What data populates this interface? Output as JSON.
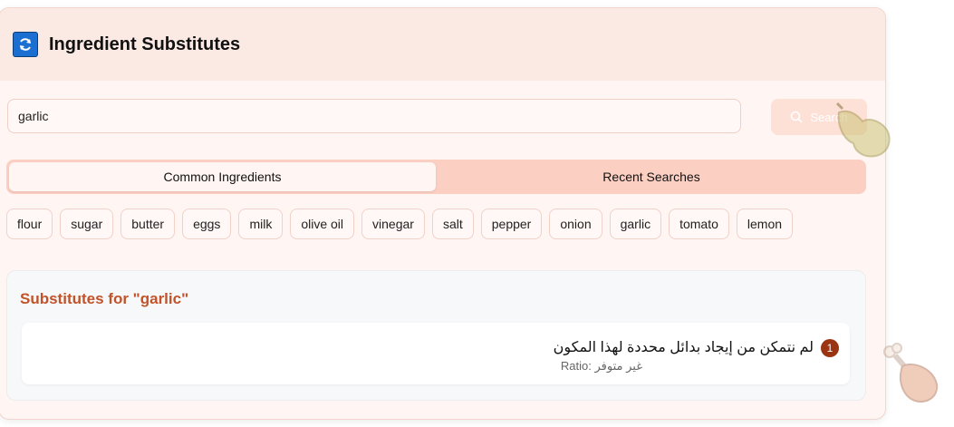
{
  "header": {
    "title": "Ingredient Substitutes",
    "icon": "refresh-icon"
  },
  "search": {
    "value": "garlic",
    "button_label": "Search"
  },
  "tabs": [
    {
      "label": "Common Ingredients"
    },
    {
      "label": "Recent Searches"
    }
  ],
  "chips": [
    "flour",
    "sugar",
    "butter",
    "eggs",
    "milk",
    "olive oil",
    "vinegar",
    "salt",
    "pepper",
    "onion",
    "garlic",
    "tomato",
    "lemon"
  ],
  "results": {
    "title": "Substitutes for \"garlic\"",
    "items": [
      {
        "number": "1",
        "text": "لم نتمكن من إيجاد بدائل محددة لهذا المكون",
        "ratio_label": "Ratio:",
        "ratio_value": "غير متوفر"
      }
    ]
  },
  "colors": {
    "accent": "#c0532a",
    "badge": "#9a3412",
    "tab_bar": "#fccfc3"
  }
}
